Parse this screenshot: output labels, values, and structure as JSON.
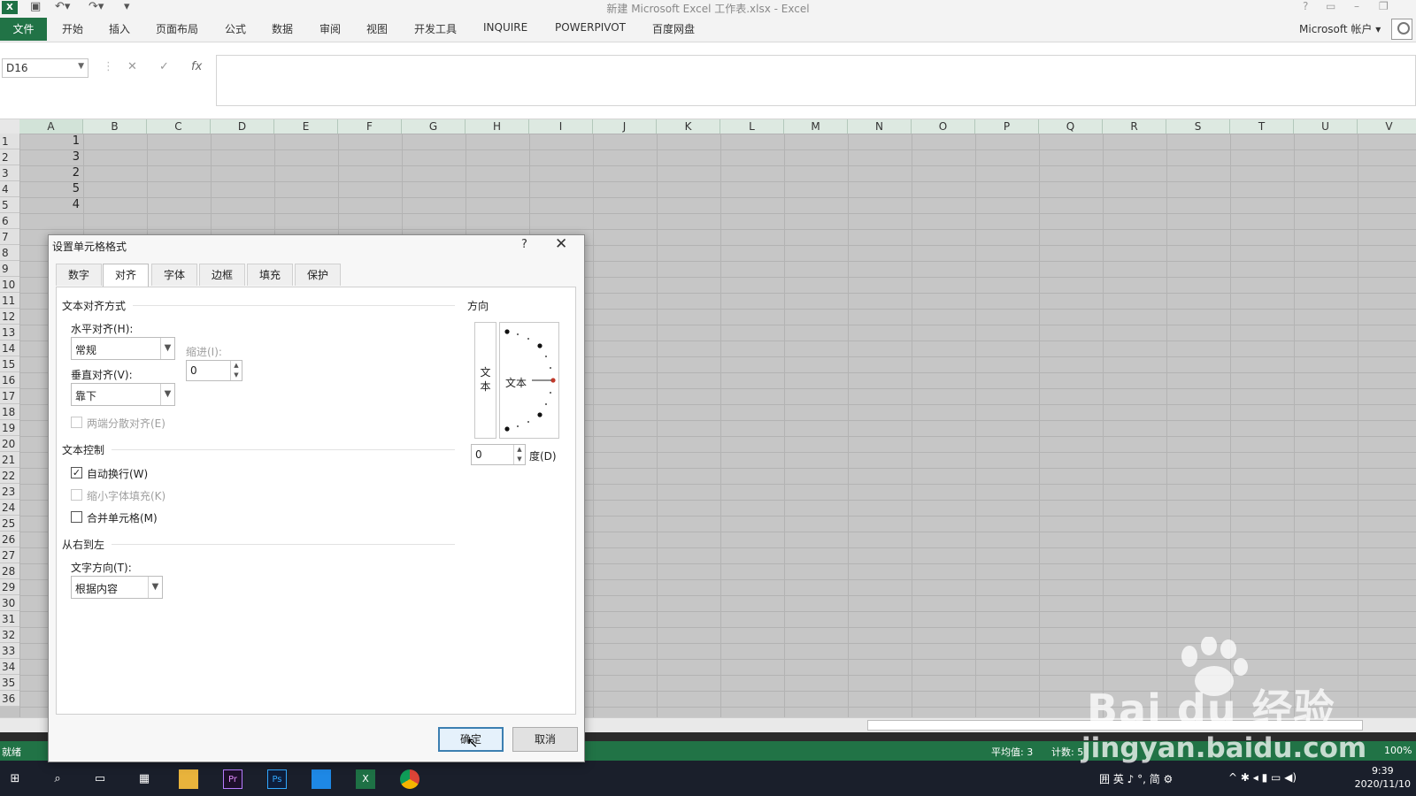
{
  "window": {
    "app_logo": "X",
    "title": "新建 Microsoft Excel 工作表.xlsx - Excel",
    "qat_icons": [
      "save-icon",
      "undo-icon",
      "redo-icon",
      "customize-icon"
    ],
    "help": "?"
  },
  "ribbon": {
    "file_tab": "文件",
    "tabs": [
      "开始",
      "插入",
      "页面布局",
      "公式",
      "数据",
      "审阅",
      "视图",
      "开发工具",
      "INQUIRE",
      "POWERPIVOT",
      "百度网盘"
    ],
    "account": "Microsoft 帐户 ▾"
  },
  "formula_bar": {
    "name_box": "D16",
    "cancel": "✕",
    "enter": "✓",
    "fx": "fx",
    "formula": ""
  },
  "grid": {
    "columns": [
      "A",
      "B",
      "C",
      "D",
      "E",
      "F",
      "G",
      "H",
      "I",
      "J",
      "K",
      "L",
      "M",
      "N",
      "O",
      "P",
      "Q",
      "R",
      "S",
      "T",
      "U",
      "V"
    ],
    "rows": [
      "1",
      "2",
      "3",
      "4",
      "5",
      "6",
      "7",
      "8",
      "9",
      "10",
      "11",
      "12",
      "13",
      "14",
      "15",
      "16",
      "17",
      "18",
      "19",
      "20",
      "21",
      "22",
      "23",
      "24",
      "25",
      "26",
      "27",
      "28",
      "29",
      "30",
      "31",
      "32",
      "33",
      "34",
      "35",
      "36"
    ],
    "column_a_values": [
      "1",
      "3",
      "2",
      "5",
      "4"
    ]
  },
  "status_bar": {
    "ready": "就绪",
    "average": "平均值: 3",
    "count": "计数: 5",
    "zoom": "100%"
  },
  "taskbar": {
    "tray_text": "囲 英 ♪ °, 简 ⚙",
    "time": "9:39",
    "date": "2020/11/10",
    "apps": [
      "start-icon",
      "search-icon",
      "task-view-icon",
      "clapper-icon",
      "folder-icon",
      "premiere-icon",
      "photoshop-icon",
      "app-icon",
      "excel-icon",
      "chrome-icon"
    ],
    "premiere_label": "Pr",
    "photoshop_label": "Ps",
    "excel_label": "X"
  },
  "dialog": {
    "title": "设置单元格格式",
    "help": "?",
    "close": "✕",
    "tabs": [
      "数字",
      "对齐",
      "字体",
      "边框",
      "填充",
      "保护"
    ],
    "active_tab": "对齐",
    "text_alignment": {
      "group": "文本对齐方式",
      "horizontal_label": "水平对齐(H):",
      "horizontal_value": "常规",
      "indent_label": "缩进(I):",
      "indent_value": "0",
      "vertical_label": "垂直对齐(V):",
      "vertical_value": "靠下",
      "distributed_label": "两端分散对齐(E)"
    },
    "text_control": {
      "group": "文本控制",
      "wrap_label": "自动换行(W)",
      "wrap_checked": true,
      "shrink_label": "缩小字体填充(K)",
      "merge_label": "合并单元格(M)"
    },
    "rtl": {
      "group": "从右到左",
      "direction_label": "文字方向(T):",
      "direction_value": "根据内容"
    },
    "orientation": {
      "group": "方向",
      "vertical_text": "文本",
      "dial_text": "文本",
      "degrees_value": "0",
      "degrees_label": "度(D)"
    },
    "ok": "确定",
    "cancel": "取消"
  },
  "watermark": {
    "brand": "Bai du 经验",
    "url": "jingyan.baidu.com"
  }
}
